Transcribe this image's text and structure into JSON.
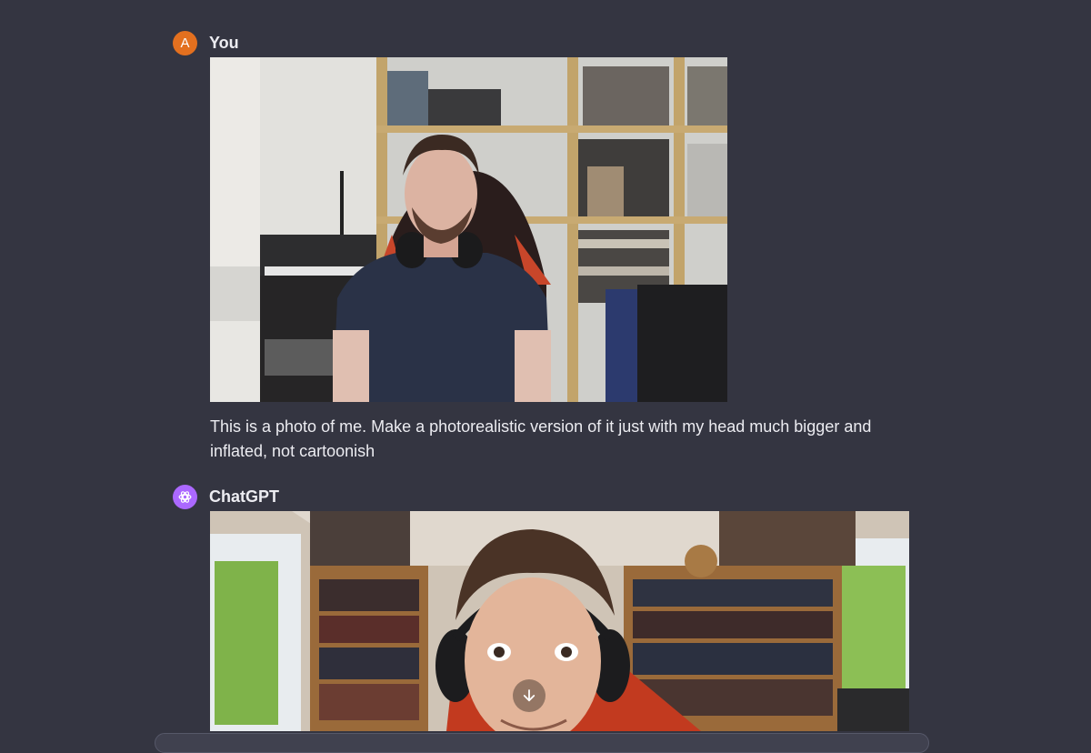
{
  "user": {
    "avatar_letter": "A",
    "author": "You",
    "message": "This is a photo of me. Make a photorealistic version of it just with my head much bigger and inflated, not cartoonish",
    "avatar_color": "#e3701f"
  },
  "assistant": {
    "author": "ChatGPT",
    "avatar_color": "#ab68ff",
    "download_icon": "arrow-down-icon"
  },
  "colors": {
    "background": "#343541",
    "text": "#ececf1"
  }
}
